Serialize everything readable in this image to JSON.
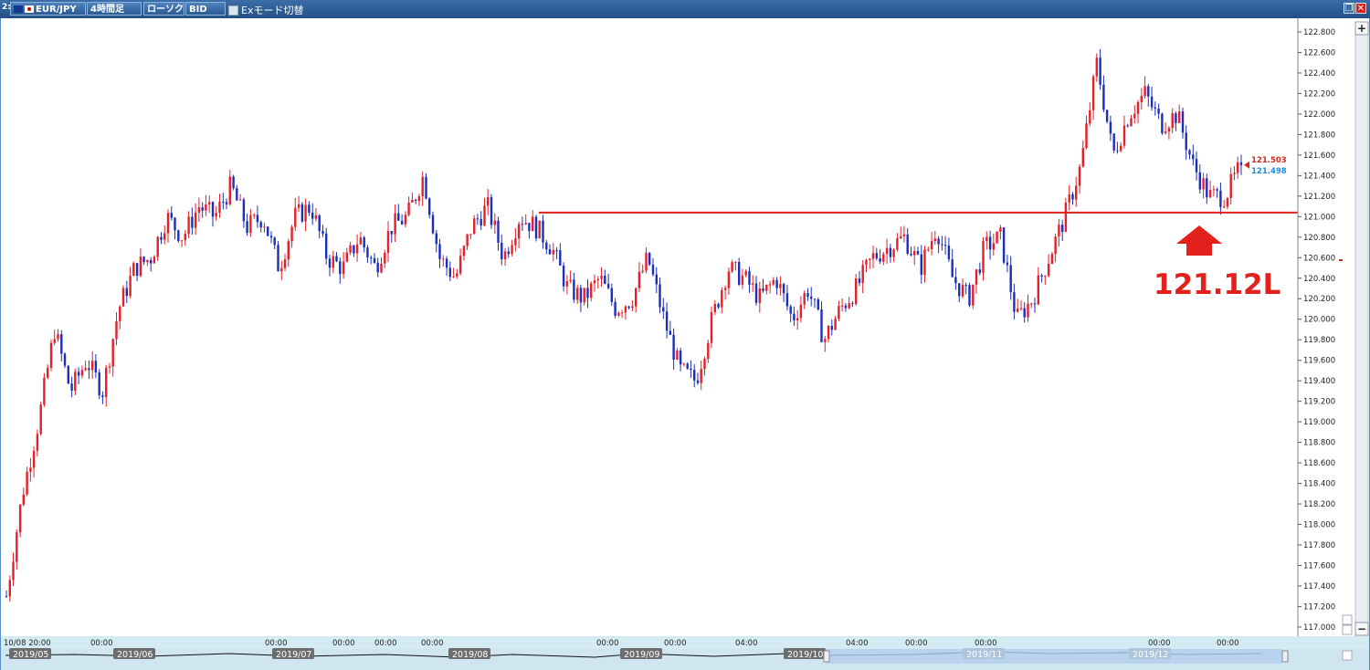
{
  "toolbar": {
    "index": "2:",
    "symbol": "EUR/JPY",
    "timeframe": "4時間足",
    "chart_type": "ローソク",
    "price_type": "BID",
    "ex_mode": "Exモード切替"
  },
  "window_controls": {
    "restore_icon": "❐",
    "close_icon": "✕",
    "zoom_in": "+",
    "zoom_out": "−"
  },
  "price_axis": {
    "ticks": [
      "122.800",
      "122.600",
      "122.400",
      "122.200",
      "122.000",
      "121.800",
      "121.600",
      "121.400",
      "121.200",
      "121.000",
      "120.800",
      "120.600",
      "120.400",
      "120.200",
      "120.000",
      "119.800",
      "119.600",
      "119.400",
      "119.200",
      "119.000",
      "118.800",
      "118.600",
      "118.400",
      "118.200",
      "118.000",
      "117.800",
      "117.600",
      "117.400",
      "117.200",
      "117.000"
    ]
  },
  "time_axis": {
    "labels": [
      "10/08 20:00",
      "00:00",
      "00:00",
      "00:00",
      "00:00",
      "00:00",
      "00:00",
      "00:00",
      "04:00",
      "04:00",
      "00:00",
      "00:00",
      "00:00",
      "00:00"
    ]
  },
  "navigator": {
    "months": [
      "2019/05",
      "2019/06",
      "2019/07",
      "2019/08",
      "2019/09",
      "2019/10",
      "2019/11",
      "2019/12"
    ]
  },
  "annotations": {
    "support_label": "121.12L",
    "support_level": 121.04
  },
  "price_markers": {
    "ask": "121.503",
    "bid": "121.498",
    "ask_color": "#d9261c",
    "bid_color": "#1a8fd6"
  },
  "colors": {
    "up": "#e5202a",
    "down": "#1b2fbf",
    "line": "#e2211c"
  },
  "chart_data": {
    "type": "candlestick",
    "title": "EUR/JPY 4時間足 BID",
    "y_ticks": [
      122.8,
      122.6,
      122.4,
      122.2,
      122.0,
      121.8,
      121.6,
      121.4,
      121.2,
      121.0,
      120.8,
      120.6,
      120.4,
      120.2,
      120.0,
      119.8,
      119.6,
      119.4,
      119.2,
      119.0,
      118.8,
      118.6,
      118.4,
      118.2,
      118.0,
      117.8,
      117.6,
      117.4,
      117.2,
      117.0
    ],
    "ylim": [
      116.95,
      122.83
    ],
    "grid": false,
    "path": [
      117.3,
      118.3,
      119.0,
      119.9,
      119.3,
      119.6,
      119.3,
      120.1,
      120.5,
      120.6,
      121.0,
      120.8,
      121.1,
      121.0,
      121.3,
      120.9,
      121.0,
      120.5,
      121.0,
      121.1,
      120.6,
      120.5,
      120.8,
      120.5,
      120.9,
      121.0,
      121.4,
      120.6,
      120.4,
      120.9,
      121.1,
      120.6,
      121.0,
      120.9,
      120.7,
      120.3,
      120.2,
      120.4,
      120.1,
      120.2,
      120.6,
      120.0,
      119.5,
      119.4,
      120.0,
      120.5,
      120.4,
      120.2,
      120.4,
      120.0,
      120.3,
      119.8,
      120.1,
      120.3,
      120.6,
      120.7,
      120.8,
      120.5,
      120.9,
      120.4,
      120.2,
      120.7,
      120.8,
      120.0,
      120.2,
      120.6,
      121.0,
      121.5,
      122.5,
      121.6,
      122.0,
      122.2,
      121.9,
      122.0,
      121.5,
      121.2,
      121.2,
      121.5
    ]
  }
}
